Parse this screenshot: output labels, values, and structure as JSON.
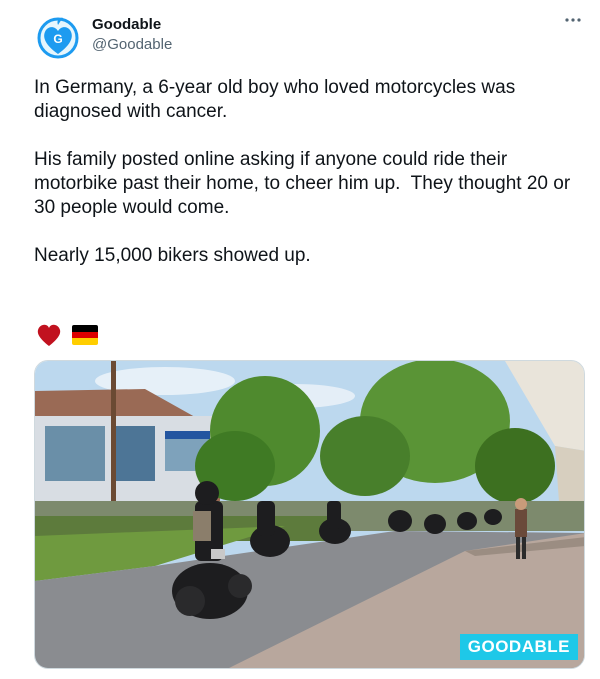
{
  "tweet": {
    "author_name": "Goodable",
    "author_handle": "@Goodable",
    "more_icon": "more-horizontal-icon",
    "paragraphs": [
      "In Germany, a 6-year old boy who loved motorcycles was diagnosed with cancer.",
      "His family posted online asking if anyone could ride their motorbike past their home, to cheer him up.  They thought 20 or 30 people would come.",
      "Nearly 15,000 bikers showed up."
    ],
    "emojis": [
      "red-heart-emoji",
      "germany-flag-emoji"
    ],
    "media": {
      "watermark": "GOODABLE"
    }
  },
  "colors": {
    "accent": "#1d9bf0",
    "heart": "#c1121f",
    "watermark_bg": "#1ec8e8",
    "text": "#0f1419",
    "secondary_text": "#536471"
  }
}
